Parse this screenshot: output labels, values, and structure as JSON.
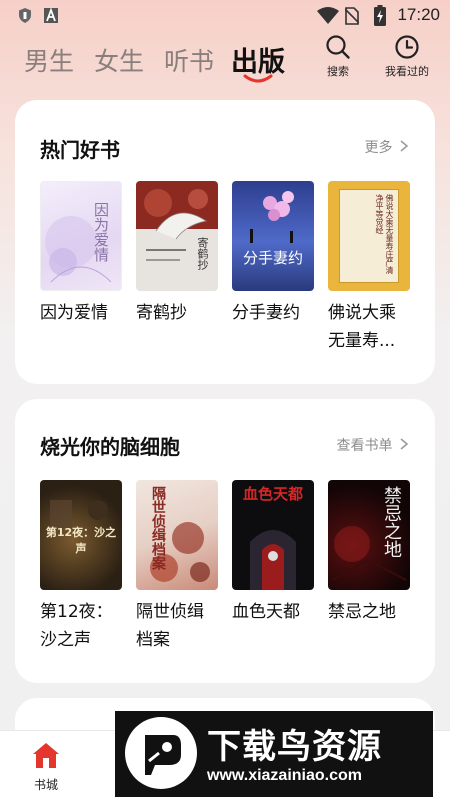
{
  "status_bar": {
    "time": "17:20",
    "left_icons": [
      "shield-icon",
      "a-icon"
    ],
    "right_icons": [
      "wifi-icon",
      "no-sim-icon",
      "battery-charging-icon"
    ]
  },
  "top_nav": {
    "tabs": [
      {
        "label": "男生",
        "active": false
      },
      {
        "label": "女生",
        "active": false
      },
      {
        "label": "听书",
        "active": false
      },
      {
        "label": "出版",
        "active": true
      }
    ],
    "search_label": "搜索",
    "history_label": "我看过的",
    "accent": "#e5362d"
  },
  "hot_books": {
    "title": "热门好书",
    "more_label": "更多",
    "books": [
      {
        "title": "因为爱情",
        "cover_text": "因为爱情"
      },
      {
        "title": "寄鹤抄",
        "cover_text": "寄鹤抄"
      },
      {
        "title": "分手妻约",
        "cover_text": "分手妻约"
      },
      {
        "title": "佛说大乘无量寿...",
        "cover_text": "佛说大乘无量寿庄严清净平等觉经"
      }
    ]
  },
  "brain_books": {
    "title": "烧光你的脑细胞",
    "more_label": "查看书单",
    "books": [
      {
        "title": "第12夜：沙之声",
        "cover_text": "第12夜：沙之声"
      },
      {
        "title": "隔世侦缉档案",
        "cover_text": "隔世侦缉档案"
      },
      {
        "title": "血色天都",
        "cover_text": "血色天都"
      },
      {
        "title": "禁忌之地",
        "cover_text": "禁忌之地"
      }
    ]
  },
  "bottom_nav": {
    "home_label": "书城"
  },
  "watermark": {
    "title": "下载鸟资源",
    "url": "www.xiazainiao.com"
  }
}
